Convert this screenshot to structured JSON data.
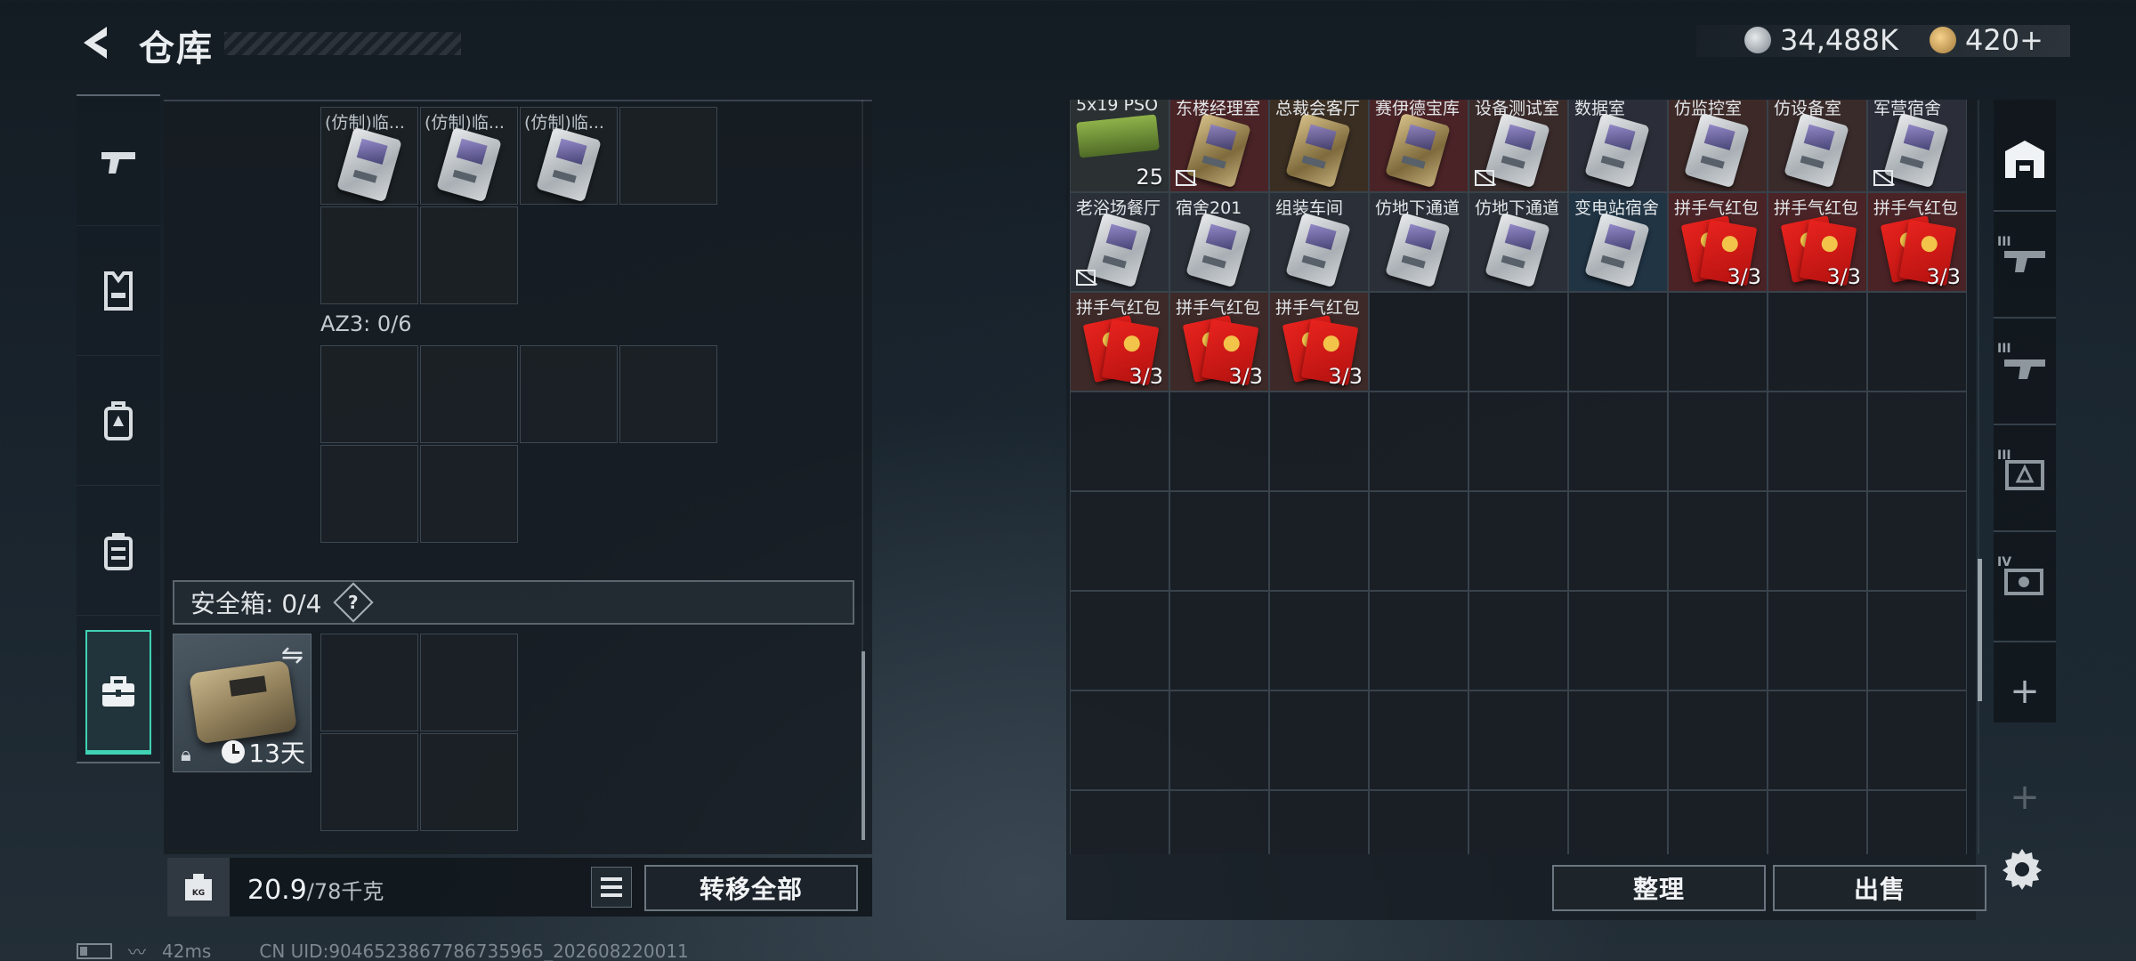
{
  "header": {
    "title": "仓库",
    "currency_primary": "34,488K",
    "currency_secondary": "420+"
  },
  "left_nav": {
    "items": [
      {
        "name": "weapon-icon"
      },
      {
        "name": "vest-icon"
      },
      {
        "name": "backpack-icon"
      },
      {
        "name": "rig-icon"
      },
      {
        "name": "secure-case-icon",
        "active": true
      }
    ]
  },
  "left_panel": {
    "top_items": [
      {
        "label": "(仿制)临..."
      },
      {
        "label": "(仿制)临..."
      },
      {
        "label": "(仿制)临..."
      }
    ],
    "az3_label": "AZ3: 0/6",
    "safe_label": "安全箱:",
    "safe_count": "0/4",
    "help_icon": "?",
    "safe_timer": "13天"
  },
  "footer_left": {
    "weight_current": "20.9",
    "weight_max": "/78千克",
    "kg_badge": "KG",
    "transfer_all": "转移全部"
  },
  "right_grid": {
    "row1": [
      {
        "name": "5x19 PSO",
        "count": "25",
        "kind": "ammo",
        "bg": "#2b3132"
      },
      {
        "name": "东楼经理室",
        "kind": "key-gold",
        "bg": "#4a2326",
        "noinsure": true
      },
      {
        "name": "总裁会客厅",
        "kind": "key-gold",
        "bg": "#3a2e22"
      },
      {
        "name": "赛伊德宝库",
        "kind": "key-gold",
        "bg": "#4a2326"
      },
      {
        "name": "设备测试室",
        "kind": "card",
        "bg": "#3a2b2b",
        "noinsure": true
      },
      {
        "name": "数据室",
        "kind": "card",
        "bg": "#2b2e38"
      },
      {
        "name": "仿监控室",
        "kind": "card",
        "bg": "#3d2a28"
      },
      {
        "name": "仿设备室",
        "kind": "card",
        "bg": "#3a2b2b"
      },
      {
        "name": "军营宿舍",
        "kind": "card",
        "bg": "#2b2e38",
        "noinsure": true
      }
    ],
    "row2": [
      {
        "name": "老浴场餐厅",
        "kind": "card",
        "bg": "#2b3038",
        "noinsure": true
      },
      {
        "name": "宿舍201",
        "kind": "card",
        "bg": "#2b3038"
      },
      {
        "name": "组装车间",
        "kind": "card",
        "bg": "#2b3038"
      },
      {
        "name": "仿地下通道",
        "kind": "card",
        "bg": "#2b3038"
      },
      {
        "name": "仿地下通道",
        "kind": "card",
        "bg": "#2b3038"
      },
      {
        "name": "变电站宿舍",
        "kind": "card",
        "bg": "#203444"
      },
      {
        "name": "拼手气红包",
        "kind": "envelope",
        "count": "3/3",
        "bg": "#4a2326"
      },
      {
        "name": "拼手气红包",
        "kind": "envelope",
        "count": "3/3",
        "bg": "#4a2326"
      },
      {
        "name": "拼手气红包",
        "kind": "envelope",
        "count": "3/3",
        "bg": "#4a2326"
      }
    ],
    "row3": [
      {
        "name": "拼手气红包",
        "kind": "envelope",
        "count": "3/3",
        "bg": "#3d2a28"
      },
      {
        "name": "拼手气红包",
        "kind": "envelope",
        "count": "3/3",
        "bg": "#3d2a28"
      },
      {
        "name": "拼手气红包",
        "kind": "envelope",
        "count": "3/3",
        "bg": "#3d2a28"
      }
    ],
    "empty_rows": 5
  },
  "footer_right": {
    "sort": "整理",
    "sell": "出售"
  },
  "right_tabs": [
    {
      "name": "warehouse-icon",
      "roman": ""
    },
    {
      "name": "expansion-iii-weapon-icon",
      "roman": "III"
    },
    {
      "name": "expansion-iii-gun-icon",
      "roman": "III"
    },
    {
      "name": "expansion-iii-medical-icon",
      "roman": "III"
    },
    {
      "name": "expansion-iv-gear-icon",
      "roman": "IV"
    }
  ],
  "status_bar": {
    "ping": "42ms",
    "uid": "CN UID:9046523867786735965_202608220011"
  },
  "colors": {
    "accent": "#3fd2b4",
    "panel": "#161c22",
    "red_envelope": "#e8231e"
  }
}
